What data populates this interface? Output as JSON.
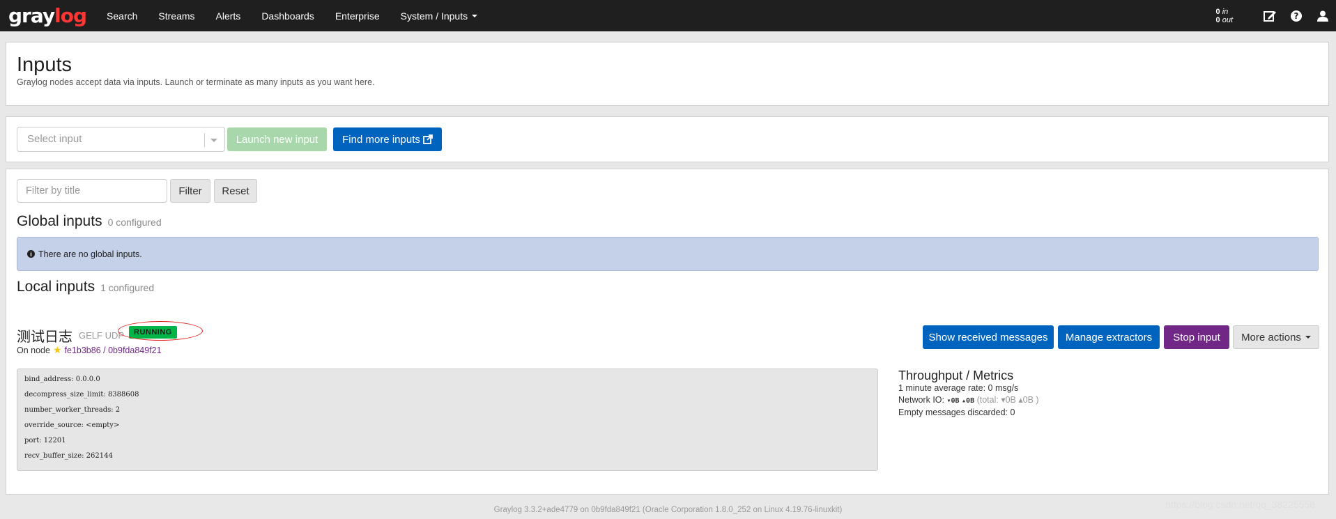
{
  "nav": {
    "logo_gray": "gray",
    "logo_accent": "log",
    "links": [
      "Search",
      "Streams",
      "Alerts",
      "Dashboards",
      "Enterprise"
    ],
    "system_menu": "System / Inputs",
    "in_count": "0",
    "in_label": "in",
    "out_count": "0",
    "out_label": "out",
    "icons": [
      "edit-icon",
      "help-icon",
      "user-icon"
    ]
  },
  "header": {
    "title": "Inputs",
    "subtitle": "Graylog nodes accept data via inputs. Launch or terminate as many inputs as you want here."
  },
  "launch": {
    "select_placeholder": "Select input",
    "launch_label": "Launch new input",
    "find_label": "Find more inputs"
  },
  "filter": {
    "placeholder": "Filter by title",
    "filter_label": "Filter",
    "reset_label": "Reset"
  },
  "global": {
    "title": "Global inputs",
    "count": "0 configured",
    "empty_message": "There are no global inputs."
  },
  "local": {
    "title": "Local inputs",
    "count": "1 configured",
    "input": {
      "name": "测试日志",
      "type": "GELF UDP",
      "status": "RUNNING",
      "node_prefix": "On node",
      "node_id": "fe1b3b86 / 0b9fda849f21",
      "config": [
        "bind_address: 0.0.0.0",
        "decompress_size_limit: 8388608",
        "number_worker_threads: 2",
        "override_source: <empty>",
        "port: 12201",
        "recv_buffer_size: 262144"
      ],
      "actions": {
        "show": "Show received messages",
        "manage": "Manage extractors",
        "stop": "Stop input",
        "more": "More actions"
      },
      "metrics": {
        "title": "Throughput / Metrics",
        "avg_rate": "1 minute average rate: 0 msg/s",
        "network_label": "Network IO:",
        "network_in": "▾0B",
        "network_out": "▴0B",
        "network_total": "(total: ▾0B ▴0B )",
        "empty_discarded": "Empty messages discarded: 0"
      }
    }
  },
  "footer": {
    "text": "Graylog 3.3.2+ade4779 on 0b9fda849f21 (Oracle Corporation 1.8.0_252 on Linux 4.19.76-linuxkit)",
    "watermark": "https://blog.csdn.net/qq_38225558"
  },
  "colors": {
    "navbar": "#1f1f1f",
    "accent": "#ff3633",
    "primary": "#0063be",
    "running": "#00b547",
    "stop": "#702785"
  }
}
